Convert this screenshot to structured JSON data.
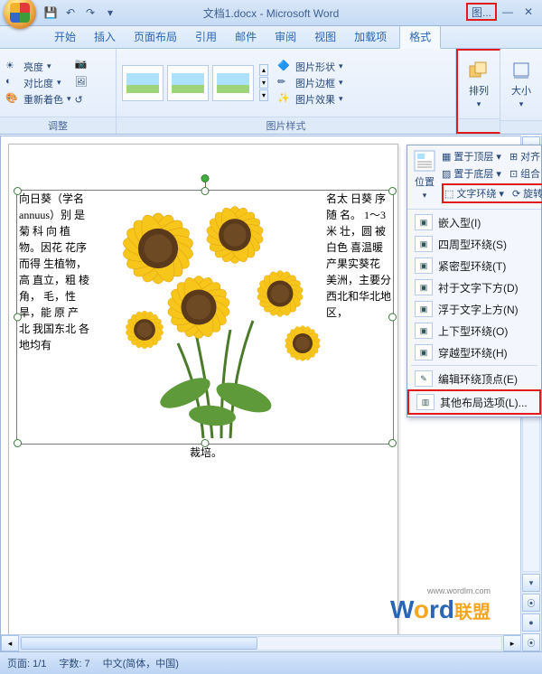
{
  "title": "文档1.docx - Microsoft Word",
  "picture_tools_label": "图...",
  "tabs": {
    "home": "开始",
    "insert": "插入",
    "layout": "页面布局",
    "refs": "引用",
    "mail": "邮件",
    "review": "审阅",
    "view": "视图",
    "addin": "加载项",
    "format": "格式"
  },
  "ribbon": {
    "adjust": {
      "brightness": "亮度",
      "contrast": "对比度",
      "recolor": "重新着色",
      "group": "调整"
    },
    "styles": {
      "shape": "图片形状",
      "border": "图片边框",
      "effects": "图片效果",
      "group": "图片样式"
    },
    "arrange": {
      "label": "排列"
    },
    "size": {
      "label": "大小"
    }
  },
  "popout": {
    "position": "位置",
    "top": "置于顶层",
    "bottom": "置于底层",
    "wrap": "文字环绕",
    "align": "对齐",
    "group": "组合",
    "rotate": "旋转"
  },
  "wrap_menu": {
    "inline": "嵌入型(I)",
    "square": "四周型环绕(S)",
    "tight": "紧密型环绕(T)",
    "behind": "衬于文字下方(D)",
    "front": "浮于文字上方(N)",
    "topbottom": "上下型环绕(O)",
    "through": "穿越型环绕(H)",
    "edit": "编辑环绕顶点(E)",
    "more": "其他布局选项(L)..."
  },
  "doc_text": {
    "left": "向日葵（学名 annuus）别 是 菊 科 向 植物。因花 花序而得 生植物，高 直立，粗 棱角， 毛，性 旱，能 原 产 北 我国东北 各地均有",
    "right": "名太 日葵 序随 名。 1～3米 壮，圆 被白色 喜温暖 产果实葵花 美洲，主要分 西北和华北地区，",
    "bottom_l": "裁培。",
    "bottom_r": ""
  },
  "status": {
    "page": "页面: 1/1",
    "words": "字数: 7",
    "lang": "中文(简体，中国)"
  },
  "watermark": {
    "url": "www.wordlm.com",
    "brand_cn": "联盟"
  }
}
